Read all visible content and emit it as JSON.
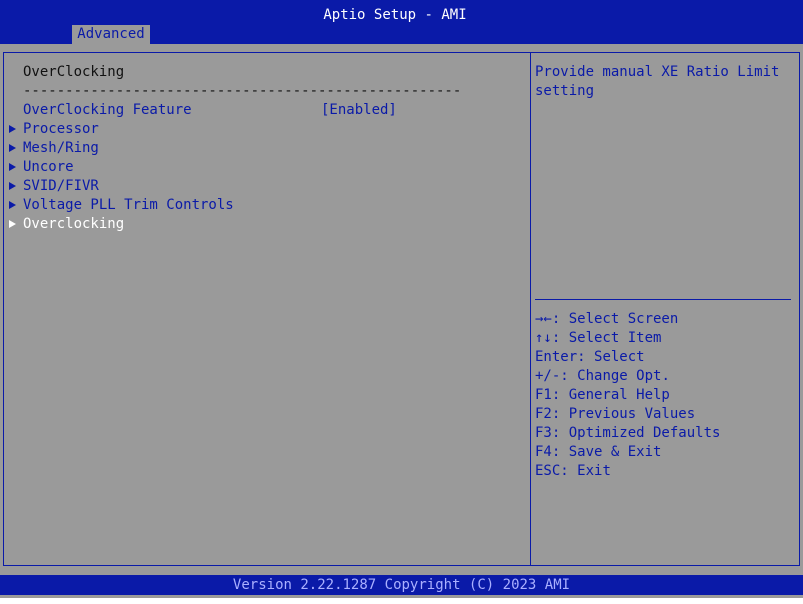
{
  "header": {
    "title": "Aptio Setup - AMI",
    "tab": "Advanced"
  },
  "main": {
    "heading": "OverClocking",
    "separator": "----------------------------------------------------",
    "feature_label": "OverClocking Feature",
    "feature_value": "[Enabled]",
    "submenus": [
      "Processor",
      "Mesh/Ring",
      "Uncore",
      "SVID/FIVR",
      "Voltage PLL Trim Controls",
      "Overclocking"
    ]
  },
  "help": {
    "description": [
      "Provide manual XE Ratio Limit",
      "setting"
    ],
    "keys": [
      {
        "key": "→←",
        "text": ": Select Screen"
      },
      {
        "key": "↑↓",
        "text": ": Select Item"
      },
      {
        "key": "Enter",
        "text": ": Select"
      },
      {
        "key": "+/-",
        "text": ": Change Opt."
      },
      {
        "key": "F1",
        "text": ": General Help"
      },
      {
        "key": "F2",
        "text": ": Previous Values"
      },
      {
        "key": "F3",
        "text": ": Optimized Defaults"
      },
      {
        "key": "F4",
        "text": ": Save & Exit"
      },
      {
        "key": "ESC",
        "text": ": Exit"
      }
    ]
  },
  "footer": {
    "text": "Version 2.22.1287 Copyright (C) 2023 AMI"
  },
  "colors": {
    "background": "#9a9a9a",
    "accent": "#0a1aa8",
    "selected": "#ffffff"
  }
}
